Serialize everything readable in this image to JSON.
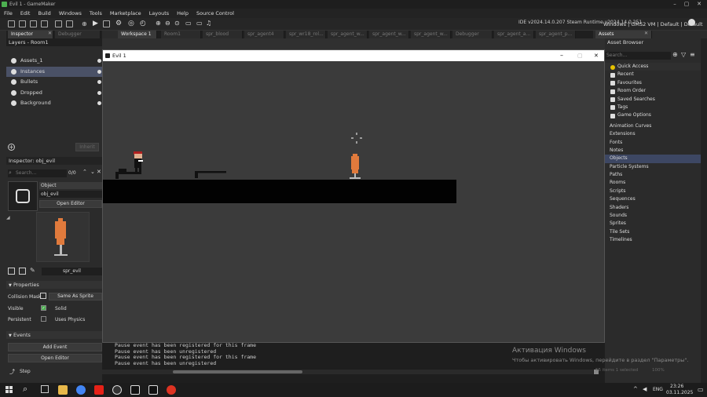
{
  "window": {
    "title": "Evil 1 - GameMaker",
    "ide_version": "IDE v2024.14.0.207 Steam  Runtime v2024.14.0.251",
    "target": "Windows  |  GMS2 VM  |  Default  |  Default"
  },
  "menu": [
    "File",
    "Edit",
    "Build",
    "Windows",
    "Tools",
    "Marketplace",
    "Layouts",
    "Help",
    "Source Control"
  ],
  "tabs": {
    "left_panel": "Inspector",
    "debugger": "Debugger",
    "workspace": "Workspace 1",
    "others": [
      "Room1",
      "spr_blood",
      "spr_agent4",
      "spr_wr18_rol...",
      "spr_agent_w...",
      "spr_agent_w...",
      "spr_agent_w...",
      "Debugger",
      "spr_agent_a...",
      "spr_agent_p..."
    ],
    "assets": "Assets"
  },
  "layers": {
    "header": "Layers - Room1",
    "items": [
      {
        "label": "Assets_1",
        "selected": false
      },
      {
        "label": "Instances",
        "selected": true
      },
      {
        "label": "Bullets",
        "selected": false
      },
      {
        "label": "Dropped",
        "selected": false
      },
      {
        "label": "Background",
        "selected": false
      }
    ],
    "inherit_label": "Inherit"
  },
  "inspector": {
    "title": "Inspector: obj_evil",
    "search_placeholder": "Search...",
    "count": "0/0",
    "section_object": "Object",
    "object_name": "obj_evil",
    "open_editor": "Open Editor",
    "sprite_name": "spr_evil",
    "properties_header": "Properties",
    "collision_mask_label": "Collision Mask",
    "collision_mask_value": "Same As Sprite",
    "visible_label": "Visible",
    "solid_label": "Solid",
    "persistent_label": "Persistent",
    "physics_label": "Uses Physics",
    "events_header": "Events",
    "add_event": "Add Event",
    "open_editor2": "Open Editor",
    "step_label": "Step"
  },
  "game_window": {
    "title": "Evil 1"
  },
  "output": {
    "lines": [
      "Pause event has been registered for this frame",
      "Pause event has been unregistered",
      "Pause event has been registered for this frame",
      "Pause event has been unregistered"
    ]
  },
  "assets": {
    "header": "Asset Browser",
    "search_placeholder": "Search...",
    "quick_access": "Quick Access",
    "qa_items": [
      "Recent",
      "Favourites",
      "Room Order",
      "Saved Searches",
      "Tags",
      "Game Options"
    ],
    "groups": [
      "Animation Curves",
      "Extensions",
      "Fonts",
      "Notes",
      "Objects",
      "Particle Systems",
      "Paths",
      "Rooms",
      "Scripts",
      "Sequences",
      "Shaders",
      "Sounds",
      "Sprites",
      "Tile Sets",
      "Timelines"
    ],
    "selected_group": "Objects",
    "status": "55 items   1 selected",
    "zoom": "100%"
  },
  "activation": {
    "line1": "Активация Windows",
    "line2": "Чтобы активировать Windows, перейдите в раздел \"Параметры\"."
  },
  "taskbar": {
    "lang": "ENG",
    "time": "23:26",
    "date": "03.11.2025"
  },
  "colors": {
    "accent": "#4a5166",
    "selected_asset": "#3d4763",
    "sprite_orange": "#e07a3c"
  }
}
